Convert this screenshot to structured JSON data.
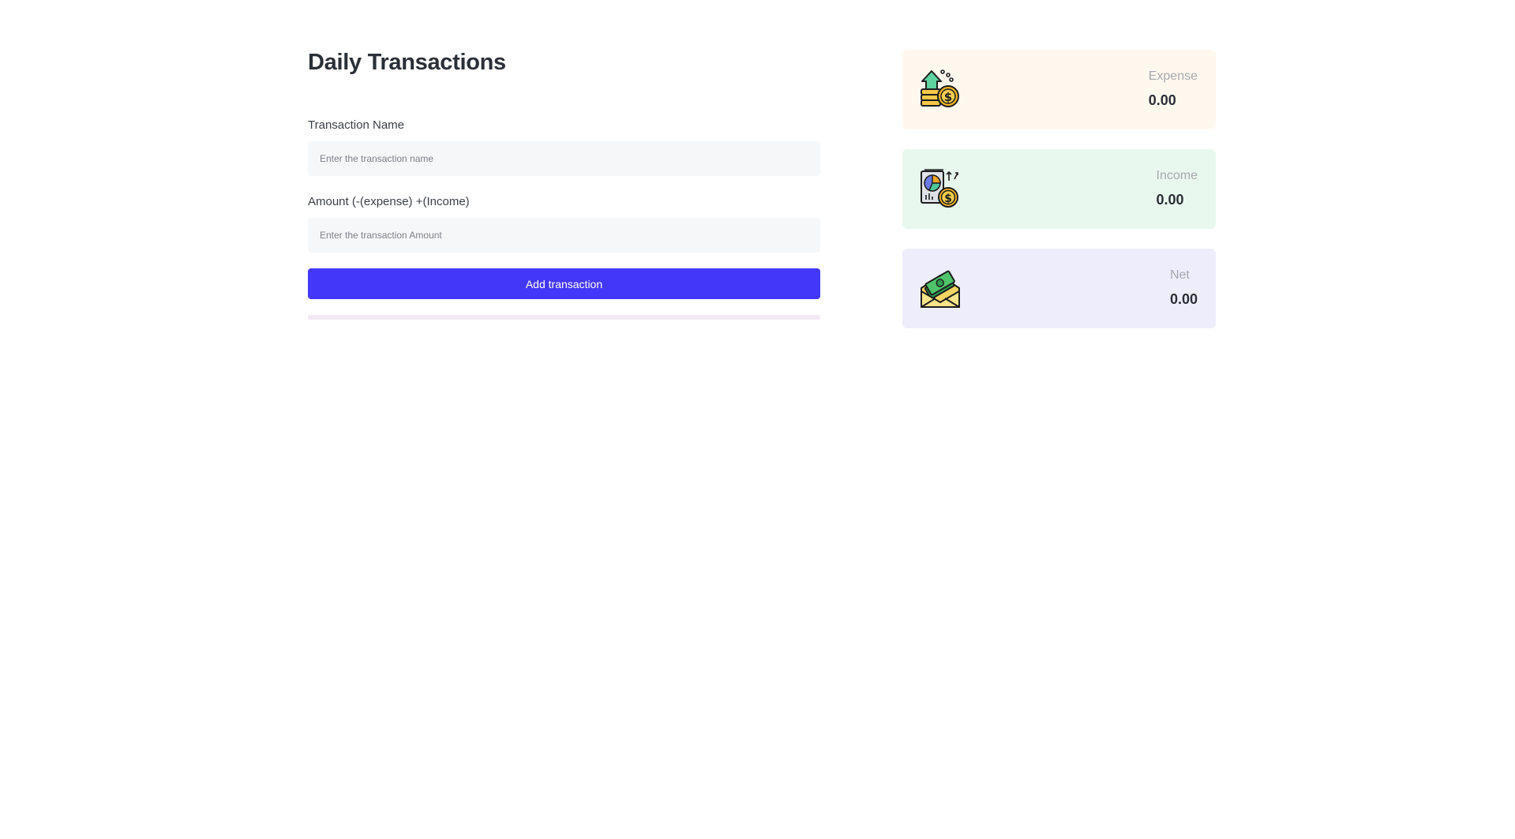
{
  "form": {
    "title": "Daily Transactions",
    "name_label": "Transaction Name",
    "name_placeholder": "Enter the transaction name",
    "name_value": "",
    "amount_label": "Amount (-(expense) +(Income)",
    "amount_placeholder": "Enter the transaction Amount",
    "amount_value": "",
    "submit_label": "Add transaction"
  },
  "summary": {
    "expense": {
      "label": "Expense",
      "value": "0.00",
      "icon": "coins-arrow-up-icon"
    },
    "income": {
      "label": "Income",
      "value": "0.00",
      "icon": "report-coin-icon"
    },
    "net": {
      "label": "Net",
      "value": "0.00",
      "icon": "money-envelope-icon"
    }
  },
  "colors": {
    "accent": "#4338fa",
    "expense_bg": "#fff8ef",
    "income_bg": "#e9f8ef",
    "net_bg": "#eeedfc",
    "input_bg": "#f6f7f8"
  }
}
